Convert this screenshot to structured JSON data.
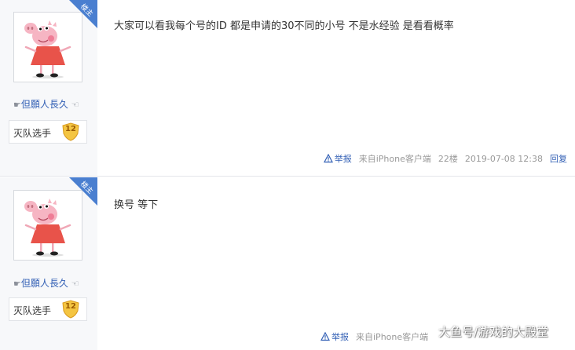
{
  "posts": [
    {
      "badge": "楼主",
      "username_prefix": "☛",
      "username": "但願人長久",
      "username_suffix": "☜",
      "title": "灭队选手",
      "level": "12",
      "content": "大家可以看我每个号的ID 都是申请的30不同的小号 不是水经验 是看看概率",
      "report": "举报",
      "source": "来自iPhone客户端",
      "floor": "22楼",
      "time": "2019-07-08 12:38",
      "reply": "回复"
    },
    {
      "badge": "楼主",
      "username_prefix": "☛",
      "username": "但願人長久",
      "username_suffix": "☜",
      "title": "灭队选手",
      "level": "12",
      "content": "换号 等下",
      "report": "举报",
      "source": "来自iPhone客户端"
    }
  ],
  "watermark": "大鱼号/游戏的大殿堂",
  "colors": {
    "accent_blue": "#3360b5",
    "badge_blue": "#4a7fd0",
    "sidebar_bg": "#f7f8fa",
    "level_gold": "#f4c542"
  },
  "icons": {
    "report": "warning-triangle-icon",
    "avatar": "peppa-pig-avatar",
    "level": "shield-level-icon"
  }
}
